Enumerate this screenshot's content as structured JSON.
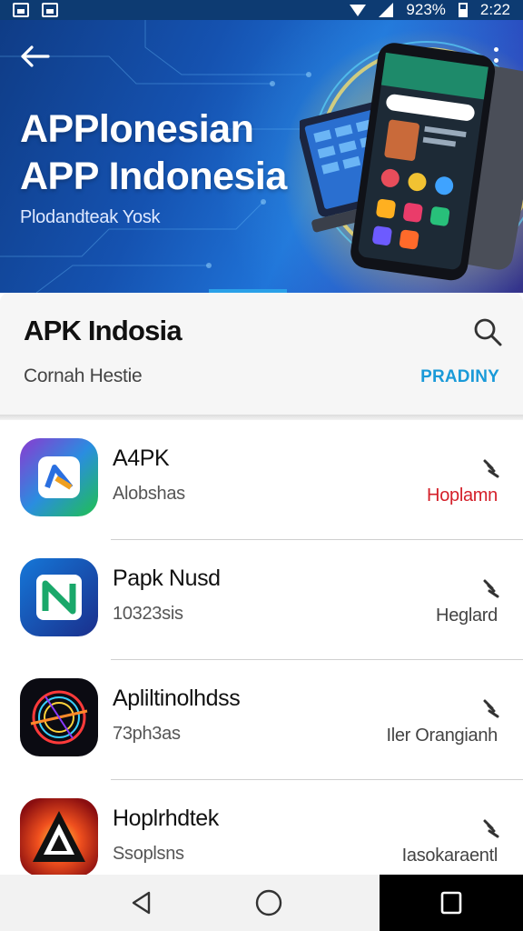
{
  "status_bar": {
    "battery_text": "923%",
    "time": "2:22"
  },
  "hero": {
    "title_line1": "APPlonesian",
    "title_line2": "APP Indonesia",
    "subtitle": "Plodandteak Yosk"
  },
  "header": {
    "title": "APK Indosia",
    "subtitle": "Cornah Hestie",
    "action_label": "PRADINY"
  },
  "apps": [
    {
      "name": "A4PK",
      "meta": "Alobshas",
      "tag": "Hoplamn",
      "tag_color": "#d4202a",
      "icon": "app-icon-gradient-arrow"
    },
    {
      "name": "Papk Nusd",
      "meta": "10323sis",
      "tag": "Heglard",
      "tag_color": "#444444",
      "icon": "app-icon-blue-n"
    },
    {
      "name": "Apliltinolhdss",
      "meta": "73ph3as",
      "tag": "Iler Orangianh",
      "tag_color": "#444444",
      "icon": "app-icon-neon-ring"
    },
    {
      "name": "Hoplrhdtek",
      "meta": "Ssoplsns",
      "tag": "Iasokaraentl",
      "tag_color": "#444444",
      "icon": "app-icon-red-triangle"
    }
  ],
  "colors": {
    "accent": "#1a9ad8",
    "hero_blue": "#1552b0",
    "tag_red": "#d4202a"
  }
}
